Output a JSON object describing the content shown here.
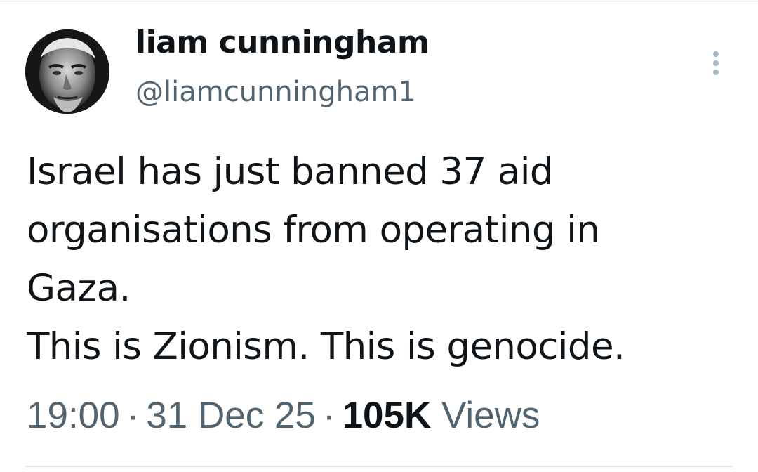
{
  "author": {
    "display_name": "liam cunningham",
    "handle": "@liamcunningham1",
    "avatar_icon": "user-avatar-photo"
  },
  "actions": {
    "more_icon": "more-vertical-icon"
  },
  "tweet": {
    "lines": [
      "Israel has just banned 37 aid",
      "organisations from operating in",
      "Gaza.",
      "This is Zionism. This is genocide."
    ]
  },
  "meta": {
    "time": "19:00",
    "separator": "·",
    "date": "31 Dec 25",
    "views_count": "105K",
    "views_label": "Views"
  },
  "colors": {
    "text_primary": "#0f1419",
    "text_secondary": "#536471",
    "divider": "#e3e6e9"
  }
}
